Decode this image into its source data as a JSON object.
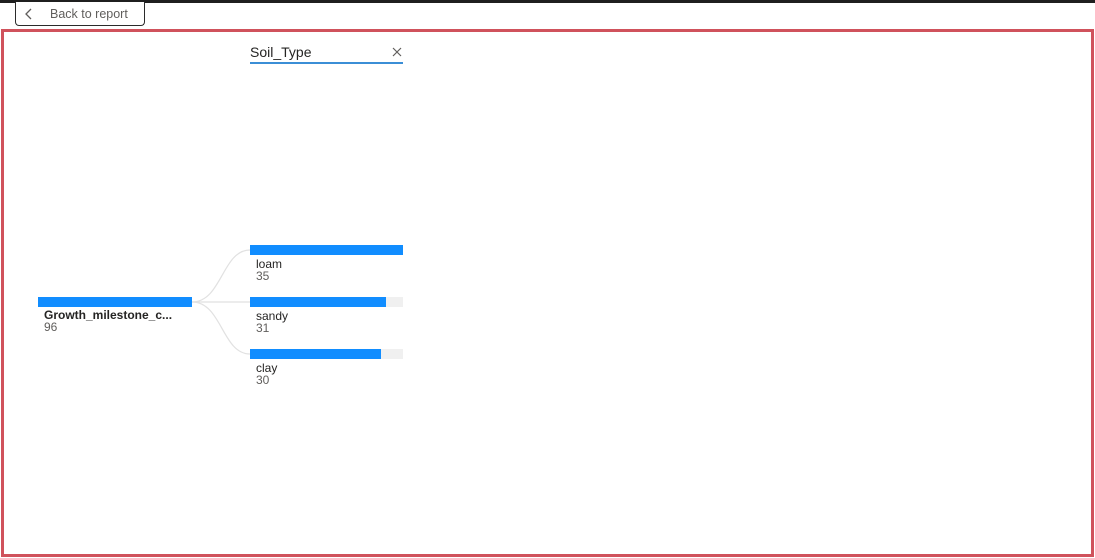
{
  "toolbar": {
    "back_label": "Back to report"
  },
  "decomposition": {
    "level_title": "Soil_Type",
    "root": {
      "label": "Growth_milestone_c...",
      "value": "96"
    },
    "children": [
      {
        "label": "loam",
        "value": "35",
        "fill_fraction": 1.0
      },
      {
        "label": "sandy",
        "value": "31",
        "fill_fraction": 0.886
      },
      {
        "label": "clay",
        "value": "30",
        "fill_fraction": 0.857
      }
    ]
  },
  "colors": {
    "bar": "#118dff",
    "frame": "#d0525c",
    "header_underline": "#3b8ed6"
  }
}
